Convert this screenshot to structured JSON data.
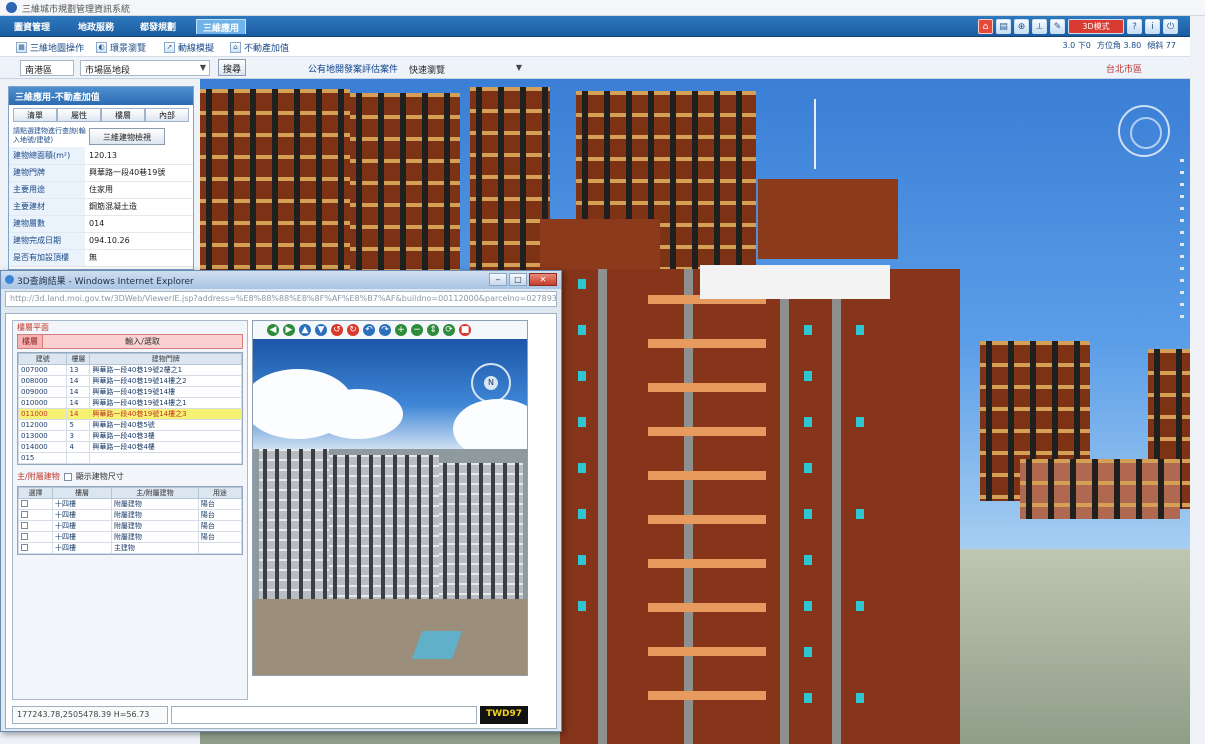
{
  "window": {
    "title": "三維城市規劃管理資訊系統"
  },
  "menu": {
    "items": [
      {
        "label": "圖資管理"
      },
      {
        "label": "地政服務"
      },
      {
        "label": "都發規劃"
      },
      {
        "label": "三維應用",
        "active": true
      }
    ],
    "tool_icons": [
      "home-icon",
      "print-icon",
      "zoom-icon",
      "measure-icon",
      "settings-icon"
    ],
    "mode_button": "3D模式",
    "extra_icons": [
      "help-icon",
      "info-icon",
      "exit-icon"
    ]
  },
  "toolbar1": {
    "buttons": [
      {
        "label": "三維地圖操作",
        "icon": "map-icon"
      },
      {
        "label": "環景瀏覽",
        "icon": "panorama-icon"
      },
      {
        "label": "動線模擬",
        "icon": "route-icon"
      },
      {
        "label": "不動產加值",
        "icon": "estate-icon"
      }
    ],
    "info": [
      "3.0 下0",
      "方位角 3.80",
      "傾斜 77"
    ]
  },
  "toolbar2": {
    "district": "南港區",
    "section": "市場區地段",
    "query_label": "搜尋",
    "link_label": "公有地開發案評估案件",
    "link_select": "快速瀏覽",
    "region_tag": "台北市區"
  },
  "info_panel": {
    "title": "三維應用-不動產加值",
    "tabs": [
      "清單",
      "屬性",
      "樓層",
      "內部"
    ],
    "desc": "請點選建物進行查詢(輸入地號/建號)",
    "desc_button": "三維建物檢視",
    "rows": [
      {
        "key": "建物總面積(m²)",
        "value": "120.13"
      },
      {
        "key": "建物門牌",
        "value": "興華路一段40巷19號"
      },
      {
        "key": "主要用途",
        "value": "住家用"
      },
      {
        "key": "主要建材",
        "value": "鋼筋混凝土造"
      },
      {
        "key": "建物層數",
        "value": "014"
      },
      {
        "key": "建物完成日期",
        "value": "094.10.26"
      },
      {
        "key": "是否有加設頂樓",
        "value": "無"
      }
    ]
  },
  "popup": {
    "title": "3D查詢結果 - Windows Internet Explorer",
    "address": "http://3d.land.moi.gov.tw/3DWeb/ViewerIE.jsp?address=%E8%88%88%E8%8F%AF%E8%B7%AF&buildno=00112000&parcelno=0278934",
    "floor_label": "樓層",
    "floor_input_placeholder": "輸入/選取",
    "section_title": "樓層平面",
    "grid": {
      "headers": [
        "建號",
        "樓層",
        "建物門牌"
      ],
      "rows": [
        {
          "cells": [
            "007000",
            "13",
            "興華路一段40巷19號2樓之1"
          ],
          "highlight": false
        },
        {
          "cells": [
            "008000",
            "14",
            "興華路一段40巷19號14樓之2"
          ],
          "highlight": false
        },
        {
          "cells": [
            "009000",
            "14",
            "興華路一段40巷19號14樓"
          ],
          "highlight": false
        },
        {
          "cells": [
            "010000",
            "14",
            "興華路一段40巷19號14樓之1"
          ],
          "highlight": false
        },
        {
          "cells": [
            "011000",
            "14",
            "興華路一段40巷19號14樓之3"
          ],
          "highlight": true
        },
        {
          "cells": [
            "012000",
            "5",
            "興華路一段40巷5號"
          ],
          "highlight": false
        },
        {
          "cells": [
            "013000",
            "3",
            "興華路一段40巷3樓"
          ],
          "highlight": false
        },
        {
          "cells": [
            "014000",
            "4",
            "興華路一段40巷4樓"
          ],
          "highlight": false
        },
        {
          "cells": [
            "015",
            "",
            ""
          ],
          "highlight": false
        }
      ]
    },
    "sub_section_title": "主/附屬建物",
    "sub_checkbox_label": "顯示建物尺寸",
    "sub_grid": {
      "headers": [
        "選擇",
        "樓層",
        "主/附屬建物",
        "用途"
      ],
      "rows": [
        [
          "",
          "十四樓",
          "附屬建物",
          "陽台"
        ],
        [
          "",
          "十四樓",
          "附屬建物",
          "陽台"
        ],
        [
          "",
          "十四樓",
          "附屬建物",
          "陽台"
        ],
        [
          "",
          "十四樓",
          "附屬建物",
          "陽台"
        ],
        [
          "",
          "十四樓",
          "主建物",
          ""
        ]
      ]
    },
    "status": {
      "coords": "177243.78,2505478.39 H=56.73",
      "crs": "TWD97"
    },
    "nav_icons": [
      "arrow-left-icon",
      "arrow-right-icon",
      "up-icon",
      "down-icon",
      "rotate-left-icon",
      "rotate-right-icon",
      "undo-icon",
      "redo-icon",
      "zoom-in-icon",
      "zoom-out-icon",
      "tilt-icon",
      "reset-icon",
      "stop-icon"
    ]
  }
}
